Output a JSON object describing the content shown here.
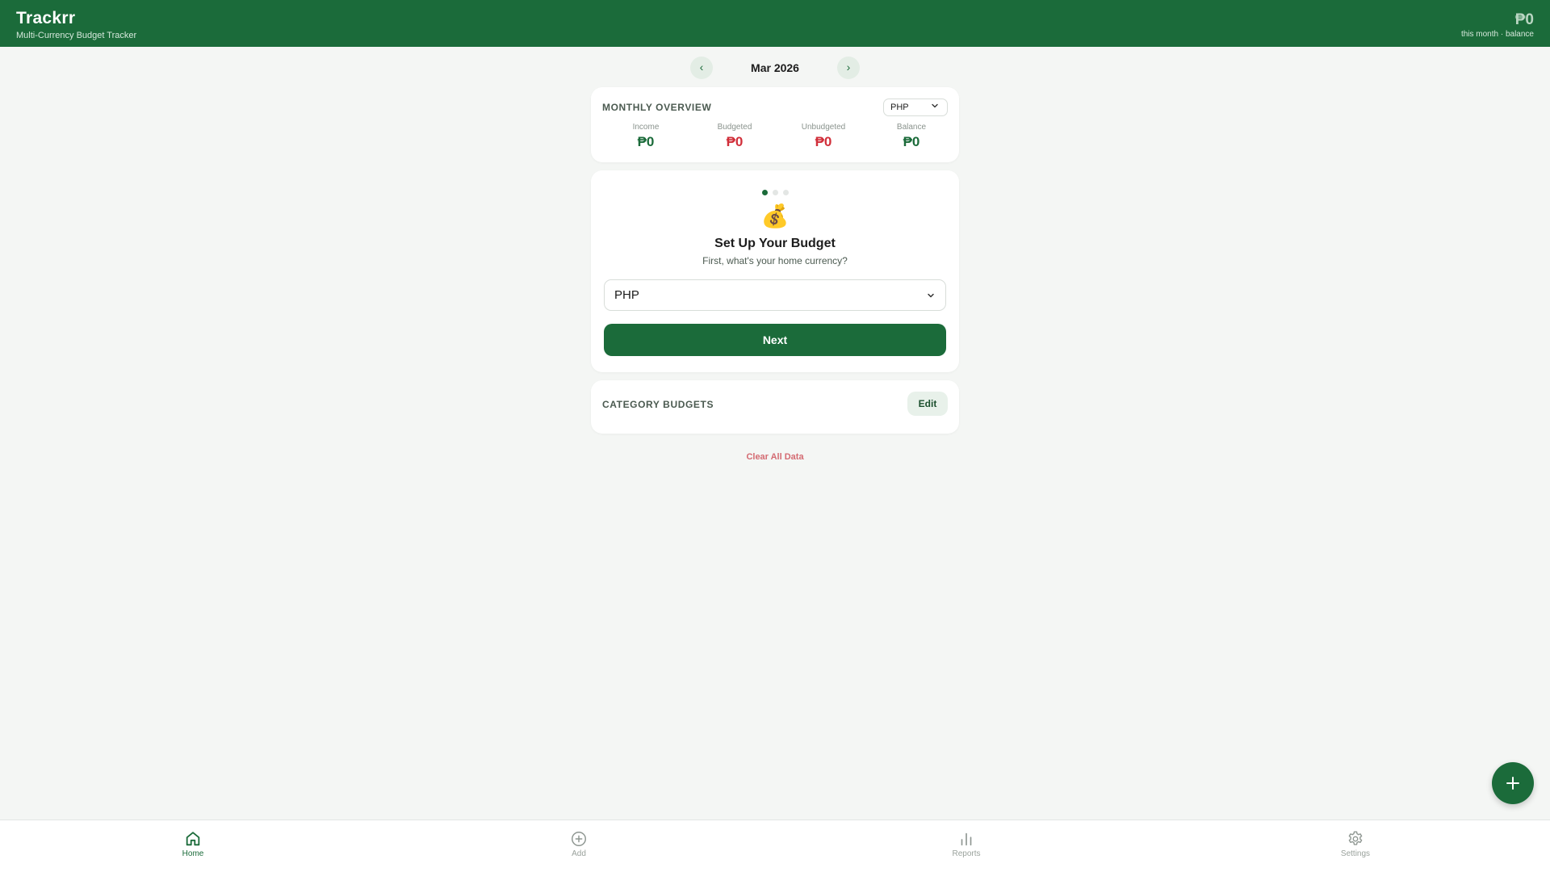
{
  "header": {
    "app_title": "Trackrr",
    "app_subtitle": "Multi-Currency Budget Tracker",
    "balance_amount": "₱0",
    "balance_label": "this month · balance"
  },
  "month_nav": {
    "prev": "‹",
    "label": "Mar 2026",
    "next": "›"
  },
  "overview": {
    "title": "MONTHLY OVERVIEW",
    "currency": "PHP",
    "stats": [
      {
        "label": "Income",
        "value": "₱0",
        "color": "#1b6b3a"
      },
      {
        "label": "Budgeted",
        "value": "₱0",
        "color": "#d12f3a"
      },
      {
        "label": "Unbudgeted",
        "value": "₱0",
        "color": "#d12f3a"
      },
      {
        "label": "Balance",
        "value": "₱0",
        "color": "#1b6b3a"
      }
    ]
  },
  "setup": {
    "step": 1,
    "total_steps": 3,
    "emoji": "💰",
    "title": "Set Up Your Budget",
    "subtitle": "First, what's your home currency?",
    "currency_value": "PHP",
    "next_label": "Next"
  },
  "category_budgets": {
    "title": "CATEGORY BUDGETS",
    "edit_label": "Edit"
  },
  "clear_label": "Clear All Data",
  "fab_icon": "plus-icon",
  "bottom_nav": [
    {
      "label": "Home",
      "icon": "home-icon",
      "active": true
    },
    {
      "label": "Add",
      "icon": "add-circle-icon",
      "active": false
    },
    {
      "label": "Reports",
      "icon": "bar-chart-icon",
      "active": false
    },
    {
      "label": "Settings",
      "icon": "gear-icon",
      "active": false
    }
  ],
  "colors": {
    "brand": "#1b6b3a",
    "negative": "#d12f3a",
    "background": "#f4f6f4"
  }
}
